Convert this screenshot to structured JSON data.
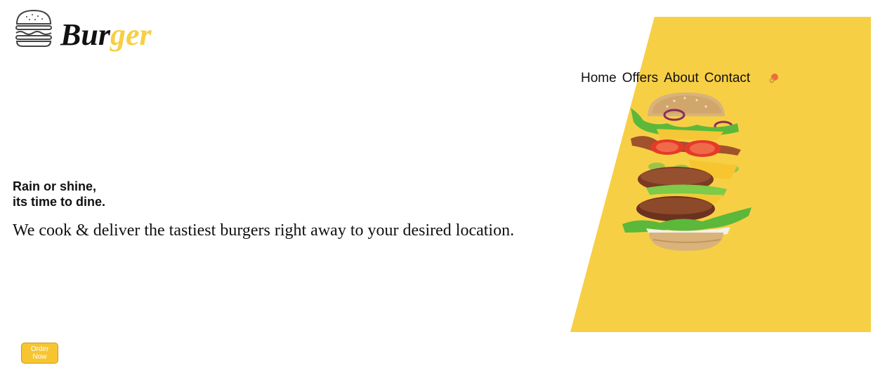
{
  "brand": {
    "name_part1": "Bur",
    "name_part2": "ger",
    "icon": "burger-logo-icon"
  },
  "nav": {
    "items": [
      {
        "label": "Home"
      },
      {
        "label": "Offers"
      },
      {
        "label": "About"
      },
      {
        "label": "Contact"
      }
    ],
    "cart_icon": "cart-icon"
  },
  "hero": {
    "tagline_line1": "Rain or shine,",
    "tagline_line2": "its time to dine.",
    "description": "We cook & deliver the tastiest burgers right away to your desired location.",
    "button_label": "Order Now",
    "image": "stacked-burger-illustration"
  },
  "colors": {
    "accent": "#f7cf45",
    "button": "#f7c530",
    "text": "#111111",
    "background": "#ffffff"
  }
}
